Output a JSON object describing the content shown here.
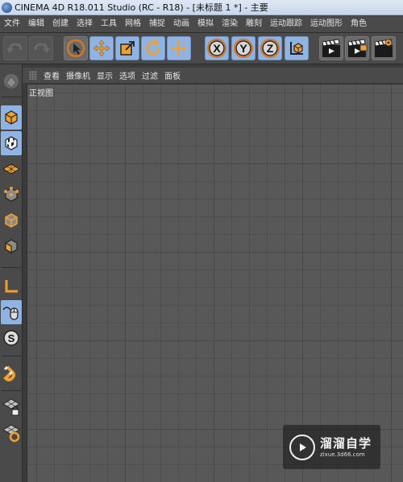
{
  "window": {
    "title": "CINEMA 4D R18.011 Studio (RC - R18) - [未标题 1 *] - 主要"
  },
  "menubar": {
    "items": [
      "文件",
      "编辑",
      "创建",
      "选择",
      "工具",
      "网格",
      "捕捉",
      "动画",
      "模拟",
      "渲染",
      "雕刻",
      "运动跟踪",
      "运动图形",
      "角色"
    ]
  },
  "toolbar": {
    "buttons": [
      {
        "icon": "undo-icon"
      },
      {
        "icon": "redo-icon"
      },
      {
        "icon": "live-selection-icon"
      },
      {
        "icon": "move-icon"
      },
      {
        "icon": "scale-icon"
      },
      {
        "icon": "rotate-icon"
      },
      {
        "icon": "recent-tool-icon"
      },
      {
        "icon": "x-axis-lock-icon",
        "label": "X"
      },
      {
        "icon": "y-axis-lock-icon",
        "label": "Y"
      },
      {
        "icon": "z-axis-lock-icon",
        "label": "Z"
      },
      {
        "icon": "coordinate-system-icon"
      },
      {
        "icon": "render-view-icon"
      },
      {
        "icon": "render-to-picture-viewer-icon"
      },
      {
        "icon": "render-settings-icon"
      }
    ]
  },
  "sidebar": {
    "tools": [
      {
        "icon": "make-editable-icon"
      },
      {
        "icon": "model-mode-icon"
      },
      {
        "icon": "texture-mode-icon"
      },
      {
        "icon": "workplane-mode-icon"
      },
      {
        "icon": "points-mode-icon"
      },
      {
        "icon": "edges-mode-icon"
      },
      {
        "icon": "polygons-mode-icon"
      },
      {
        "icon": "axis-mode-icon"
      },
      {
        "icon": "tweak-mode-icon"
      },
      {
        "icon": "snap-icon",
        "label": "S"
      },
      {
        "icon": "magnet-icon"
      },
      {
        "icon": "workplane-lock-icon"
      },
      {
        "icon": "grid-snap-icon"
      }
    ]
  },
  "viewport": {
    "menu": [
      "查看",
      "摄像机",
      "显示",
      "选项",
      "过滤",
      "面板"
    ],
    "label": "正视图"
  },
  "watermark": {
    "main": "溜溜自学",
    "sub": "zixue.3d66.com"
  },
  "colors": {
    "accent_orange": "#f0a030",
    "active_blue": "#8fb4e3",
    "panel": "#4a4a4a",
    "viewport": "#585858"
  }
}
